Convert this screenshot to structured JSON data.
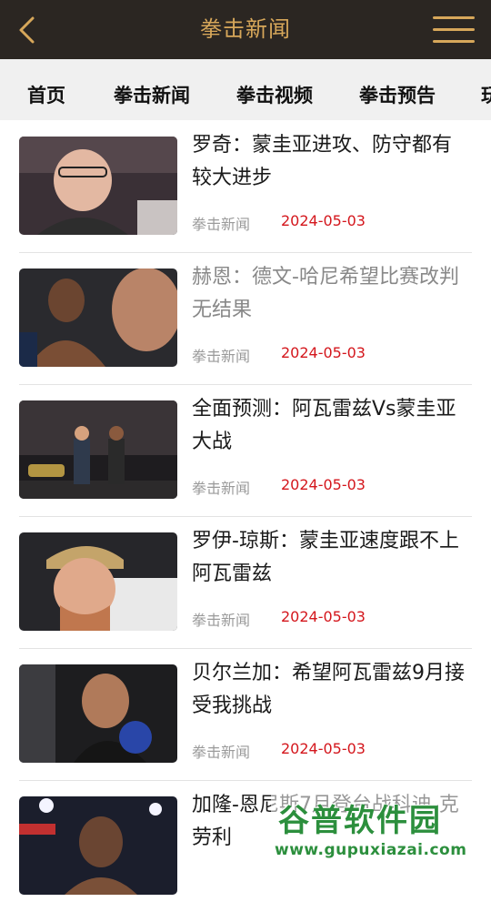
{
  "header": {
    "title": "拳击新闻",
    "back_icon": "chevron-left-icon",
    "menu_icon": "hamburger-menu-icon",
    "accent_color": "#d7a75a",
    "bar_color": "#2b2622"
  },
  "tabs": [
    {
      "label": "首页"
    },
    {
      "label": "拳击新闻"
    },
    {
      "label": "拳击视频"
    },
    {
      "label": "拳击预告"
    },
    {
      "label": "玩"
    }
  ],
  "articles": [
    {
      "title": "罗奇：蒙圭亚进攻、防守都有较大进步",
      "category": "拳击新闻",
      "date": "2024-05-03",
      "read": false
    },
    {
      "title": "赫恩：德文-哈尼希望比赛改判无结果",
      "category": "拳击新闻",
      "date": "2024-05-03",
      "read": true
    },
    {
      "title": "全面预测：阿瓦雷兹Vs蒙圭亚大战",
      "category": "拳击新闻",
      "date": "2024-05-03",
      "read": false
    },
    {
      "title": "罗伊-琼斯：蒙圭亚速度跟不上阿瓦雷兹",
      "category": "拳击新闻",
      "date": "2024-05-03",
      "read": false
    },
    {
      "title": "贝尔兰加：希望阿瓦雷兹9月接受我挑战",
      "category": "拳击新闻",
      "date": "2024-05-03",
      "read": false
    },
    {
      "title": "加隆-恩尼斯7月登台战科迪-克劳利",
      "category": "",
      "date": "",
      "read": false
    }
  ],
  "watermark": {
    "name": "谷普软件园",
    "url": "www.gupuxiazai.com"
  },
  "colors": {
    "date_red": "#d4161c",
    "meta_gray": "#9a9a9a",
    "watermark_green": "#2c8f3d"
  }
}
